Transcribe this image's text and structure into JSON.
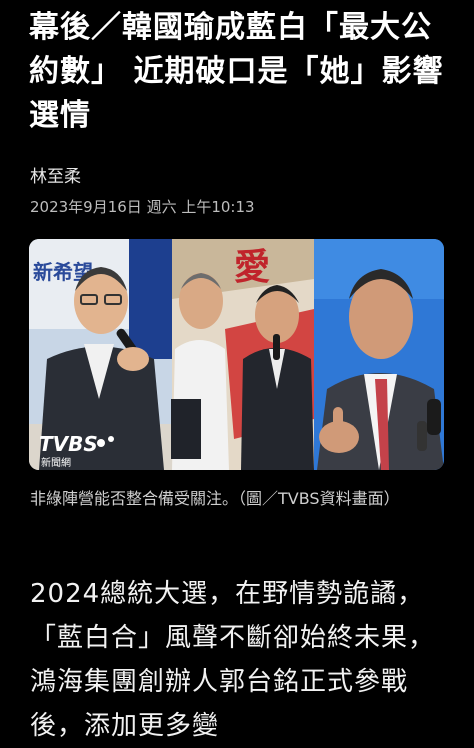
{
  "article": {
    "headline": "幕後／韓國瑜成藍白「最大公約數」 近期破口是「她」影響選情",
    "author": "林至柔",
    "timestamp": "2023年9月16日 週六 上午10:13",
    "image": {
      "watermark": "TVBS",
      "watermark_sub": "新聞網",
      "banner_text": "新希望",
      "banner_char": "愛"
    },
    "caption": "非綠陣營能否整合備受關注。（圖／TVBS資料畫面）",
    "body": "2024總統大選，在野情勢詭譎，「藍白合」風聲不斷卻始終未果，鴻海集團創辦人郭台銘正式參戰後，添加更多變"
  }
}
